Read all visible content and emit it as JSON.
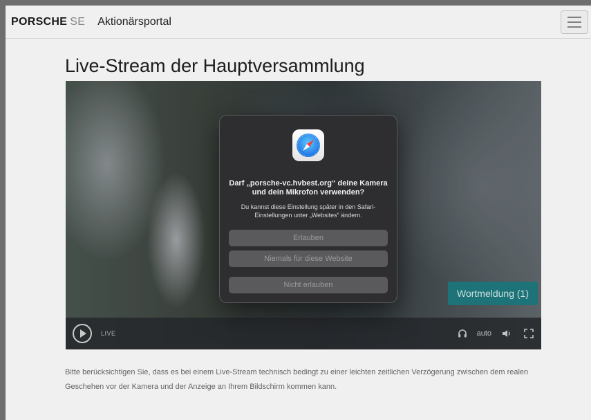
{
  "navbar": {
    "brand_main": "PORSCHE",
    "brand_suffix": "SE",
    "portal_title": "Aktionärsportal"
  },
  "main": {
    "heading": "Live-Stream der Hauptversammlung",
    "notice": "Bitte berücksichtigen Sie, dass es bei einem Live-Stream technisch bedingt zu einer leichten zeitlichen Verzögerung zwischen dem realen Geschehen vor der Kamera und der Anzeige an Ihrem Bildschirm kommen kann."
  },
  "player": {
    "live_label": "LIVE",
    "quality": "auto",
    "request_button": "Wortmeldung (1)",
    "request_button_color": "#1f7b7f",
    "icons": [
      "play-icon",
      "headphones-icon",
      "volume-icon",
      "fullscreen-icon"
    ]
  },
  "dialog": {
    "title": "Darf „porsche-vc.hvbest.org“ deine Kamera und dein Mikrofon verwenden?",
    "message": "Du kannst diese Einstellung später in den Safari-Einstellungen unter „Websites“ ändern.",
    "buttons": {
      "allow": "Erlauben",
      "never": "Niemals für diese Website",
      "deny": "Nicht erlauben"
    },
    "icon": "safari-icon"
  }
}
